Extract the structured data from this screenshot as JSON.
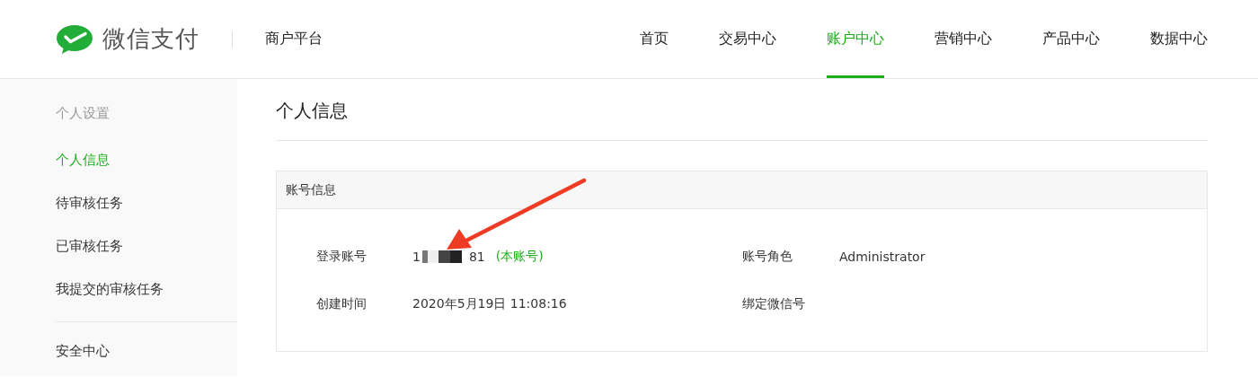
{
  "header": {
    "logo_text": "微信支付",
    "platform": "商户平台",
    "nav": [
      {
        "label": "首页",
        "selected": false
      },
      {
        "label": "交易中心",
        "selected": false
      },
      {
        "label": "账户中心",
        "selected": true
      },
      {
        "label": "营销中心",
        "selected": false
      },
      {
        "label": "产品中心",
        "selected": false
      },
      {
        "label": "数据中心",
        "selected": false
      }
    ]
  },
  "sidebar": {
    "groups": [
      {
        "heading": "个人设置",
        "items": [
          {
            "label": "个人信息",
            "selected": true
          },
          {
            "label": "待审核任务",
            "selected": false
          },
          {
            "label": "已审核任务",
            "selected": false
          },
          {
            "label": "我提交的审核任务",
            "selected": false
          }
        ]
      },
      {
        "items": [
          {
            "label": "安全中心",
            "selected": false
          }
        ]
      }
    ]
  },
  "page_title": "个人信息",
  "panel": {
    "title": "账号信息",
    "fields": [
      {
        "kind": "account",
        "label": "登录账号",
        "value_start": "1",
        "value_end": "81",
        "note": "(本账号)"
      },
      {
        "kind": "text",
        "label": "账号角色",
        "value": "Administrator"
      },
      {
        "kind": "text",
        "label": "创建时间",
        "value": "2020年5月19日 11:08:16"
      },
      {
        "kind": "text",
        "label": "绑定微信号"
      }
    ]
  }
}
